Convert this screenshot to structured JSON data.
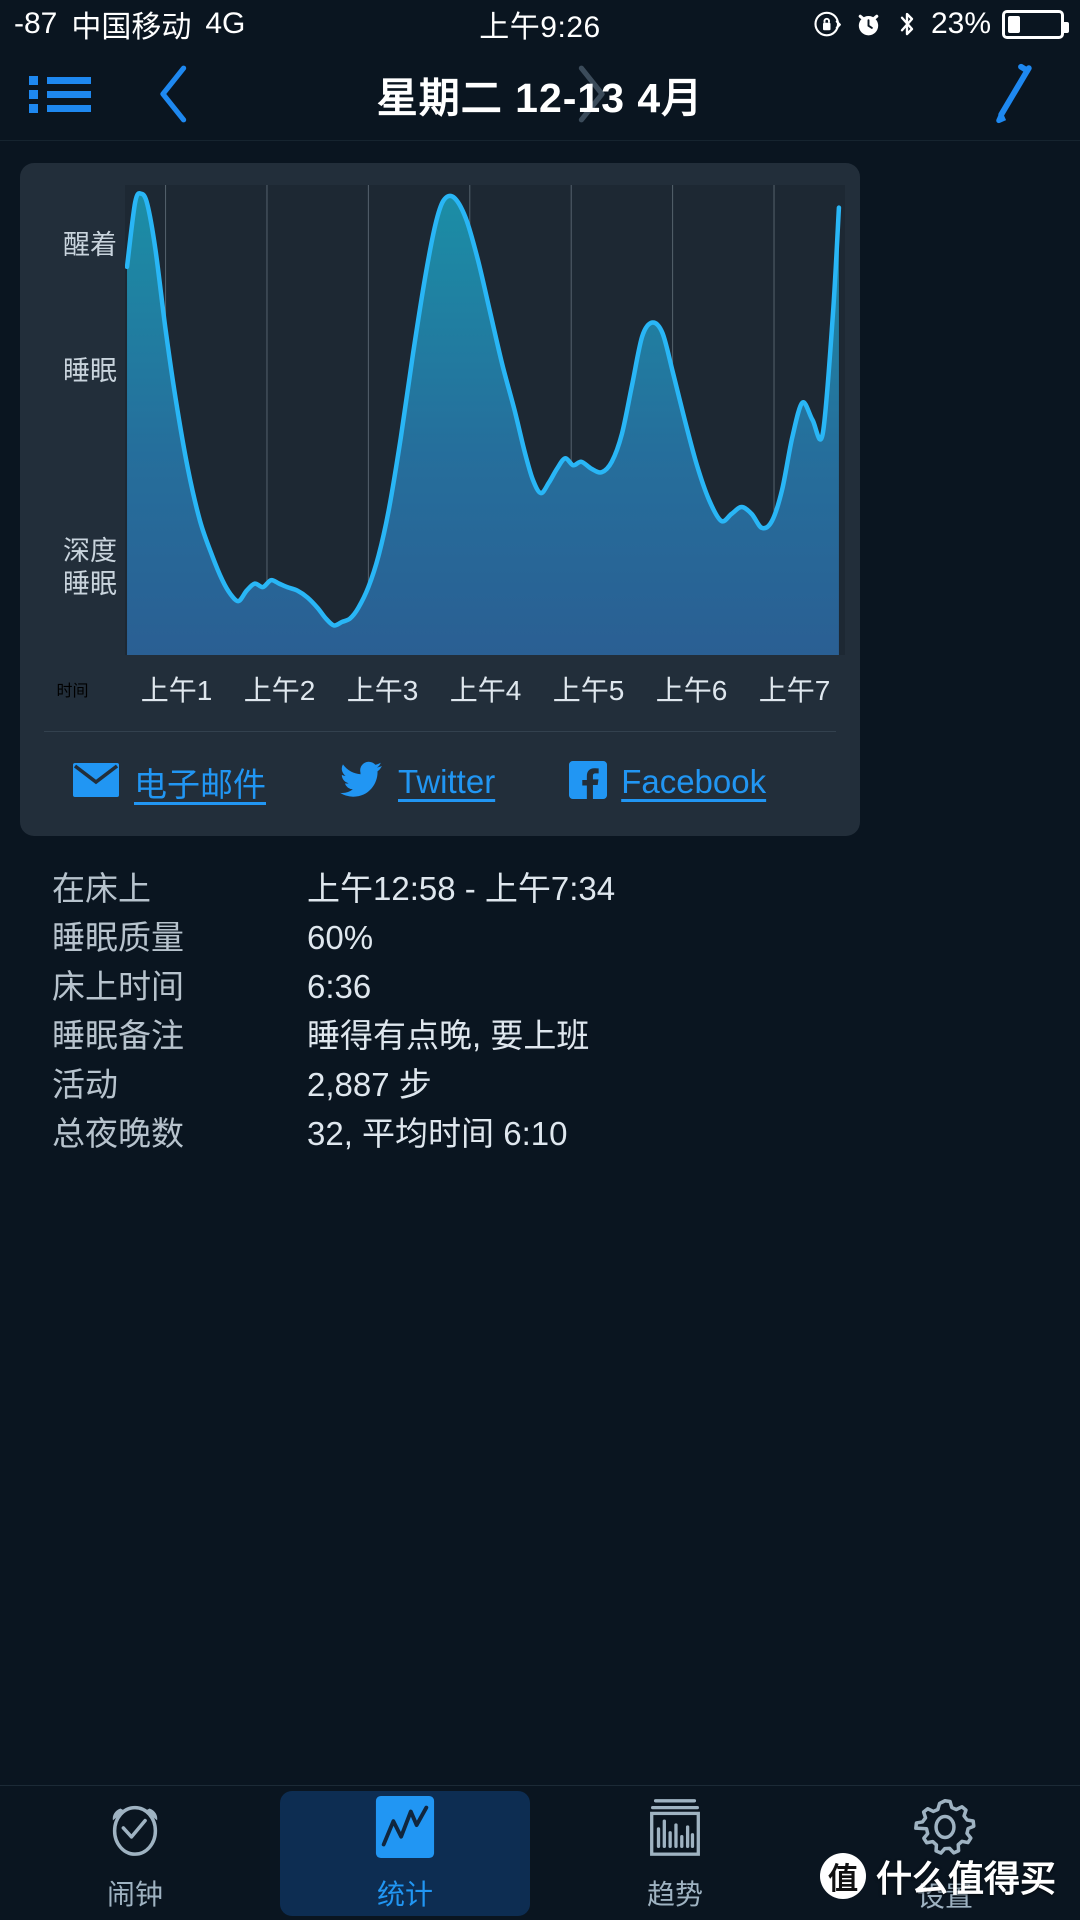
{
  "statusbar": {
    "signal": "-87",
    "carrier": "中国移动",
    "network": "4G",
    "time": "上午9:26",
    "battery_percent": "23%",
    "battery_level": 23,
    "icons": [
      "rotation-lock-icon",
      "alarm-icon",
      "bluetooth-icon",
      "battery-icon"
    ]
  },
  "navbar": {
    "menu_icon": "list-icon",
    "prev_icon": "chevron-left-icon",
    "title": "星期二 12-13 4月",
    "next_icon": "chevron-right-icon",
    "edit_icon": "pencil-icon"
  },
  "share": {
    "email_label": "电子邮件",
    "twitter_label": "Twitter",
    "facebook_label": "Facebook"
  },
  "stats": {
    "rows": [
      {
        "key": "在床上",
        "value": "上午12:58 - 上午7:34"
      },
      {
        "key": "睡眠质量",
        "value": "60%"
      },
      {
        "key": "床上时间",
        "value": "6:36"
      },
      {
        "key": "睡眠备注",
        "value": "睡得有点晚, 要上班"
      },
      {
        "key": "活动",
        "value": "2,887 步"
      },
      {
        "key": "总夜晚数",
        "value": "32, 平均时间 6:10"
      }
    ]
  },
  "tabs": [
    {
      "label": "闹钟",
      "icon": "alarm-clock-icon",
      "active": false
    },
    {
      "label": "统计",
      "icon": "line-chart-icon",
      "active": true
    },
    {
      "label": "趋势",
      "icon": "bar-chart-icon",
      "active": false
    },
    {
      "label": "设置",
      "icon": "gear-icon",
      "active": false
    }
  ],
  "watermark": {
    "logo": "值",
    "text": "什么值得买"
  },
  "colors": {
    "accent": "#2196f3",
    "curve": "#29b6f6",
    "card": "#222e3a",
    "background": "#0a1520",
    "plot_bg": "#1d2833",
    "fill_top": "#1d8ea3",
    "fill_bottom": "#2b6a99"
  },
  "chart_data": {
    "type": "area",
    "title": "",
    "xlabel": "时间",
    "ylabel": "",
    "ytick_labels": [
      "醒着",
      "睡眠",
      "深度睡眠"
    ],
    "ytick_values": [
      3,
      2,
      1
    ],
    "ylim": [
      0.45,
      3.15
    ],
    "xtick_labels": [
      "上午1",
      "上午2",
      "上午3",
      "上午4",
      "上午5",
      "上午6",
      "上午7"
    ],
    "xtick_values": [
      1,
      2,
      3,
      4,
      5,
      6,
      7
    ],
    "xlim": [
      0.6,
      7.7
    ],
    "grid": true,
    "grid_axis": "x",
    "legend": false,
    "x": [
      0.62,
      0.7,
      0.76,
      0.82,
      0.9,
      1.0,
      1.1,
      1.22,
      1.34,
      1.46,
      1.56,
      1.64,
      1.72,
      1.8,
      1.88,
      1.96,
      2.04,
      2.12,
      2.2,
      2.3,
      2.4,
      2.5,
      2.58,
      2.66,
      2.74,
      2.82,
      2.9,
      3.0,
      3.1,
      3.2,
      3.32,
      3.44,
      3.56,
      3.66,
      3.74,
      3.84,
      3.96,
      4.08,
      4.2,
      4.32,
      4.44,
      4.54,
      4.62,
      4.7,
      4.78,
      4.86,
      4.94,
      5.02,
      5.1,
      5.2,
      5.3,
      5.4,
      5.5,
      5.6,
      5.7,
      5.8,
      5.9,
      6.0,
      6.12,
      6.24,
      6.36,
      6.48,
      6.58,
      6.68,
      6.78,
      6.88,
      6.98,
      7.08,
      7.18,
      7.28,
      7.38,
      7.48,
      7.58,
      7.64
    ],
    "y": [
      2.68,
      3.05,
      3.1,
      3.04,
      2.78,
      2.32,
      1.92,
      1.52,
      1.22,
      1.02,
      0.88,
      0.8,
      0.76,
      0.82,
      0.86,
      0.84,
      0.88,
      0.86,
      0.84,
      0.82,
      0.78,
      0.72,
      0.66,
      0.62,
      0.64,
      0.66,
      0.72,
      0.84,
      1.02,
      1.28,
      1.7,
      2.18,
      2.62,
      2.92,
      3.06,
      3.08,
      2.96,
      2.72,
      2.42,
      2.12,
      1.86,
      1.62,
      1.46,
      1.38,
      1.44,
      1.52,
      1.58,
      1.54,
      1.56,
      1.52,
      1.5,
      1.56,
      1.72,
      2.0,
      2.28,
      2.36,
      2.3,
      2.08,
      1.8,
      1.54,
      1.34,
      1.22,
      1.26,
      1.3,
      1.26,
      1.18,
      1.22,
      1.4,
      1.7,
      1.9,
      1.8,
      1.72,
      2.4,
      3.02
    ],
    "annotations": []
  }
}
